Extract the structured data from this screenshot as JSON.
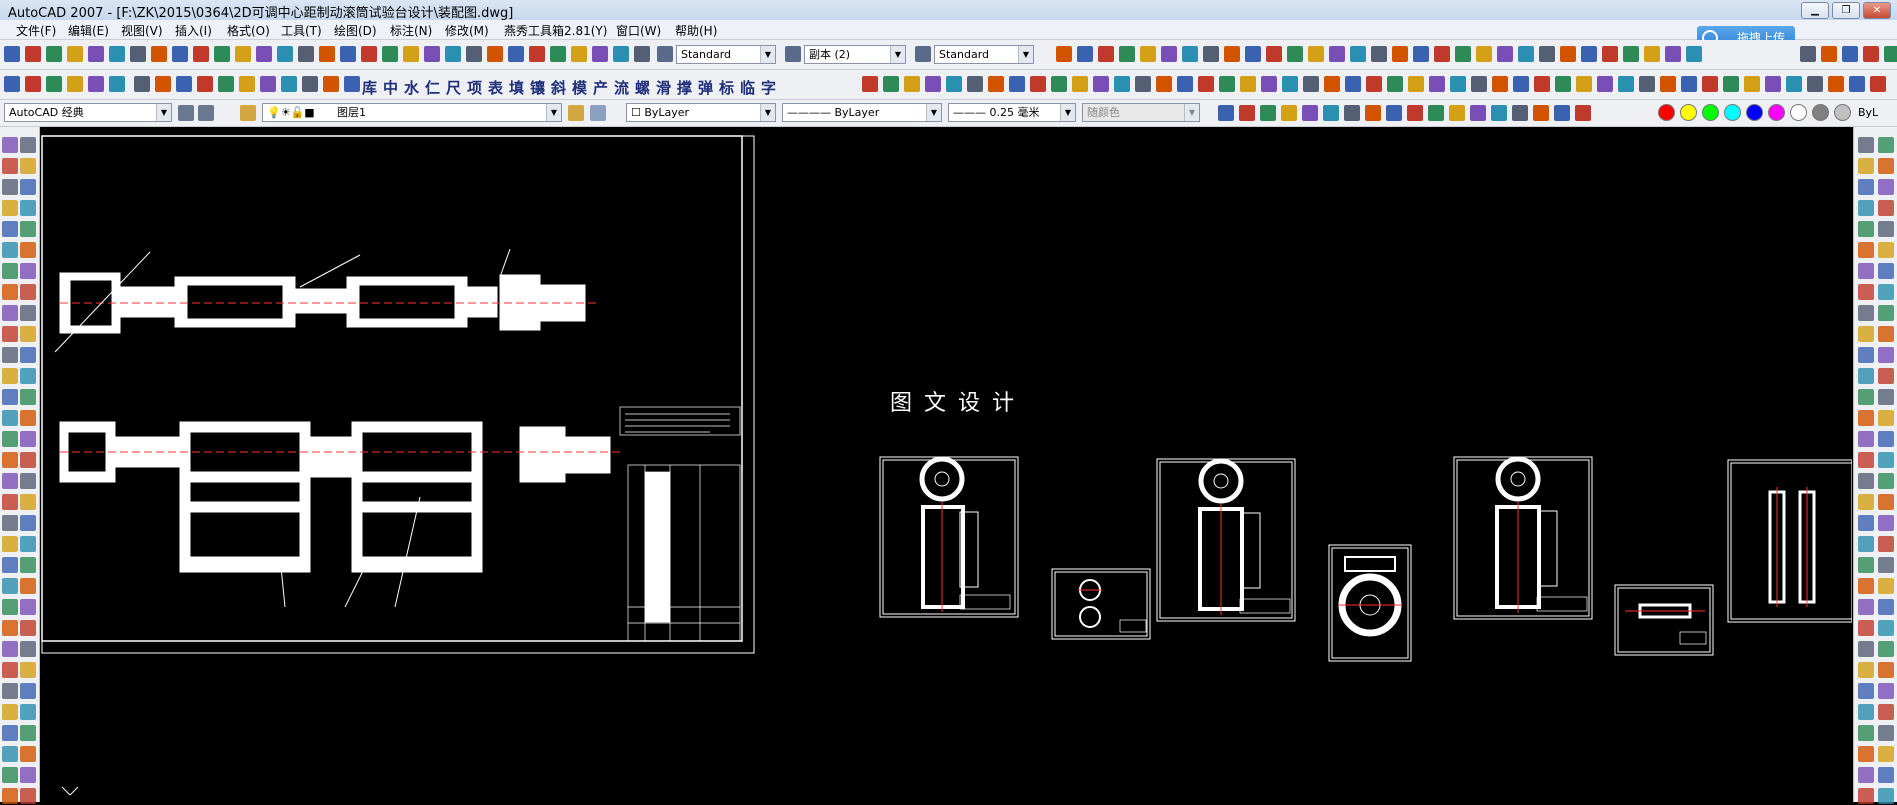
{
  "window": {
    "title": "AutoCAD 2007 - [F:\\ZK\\2015\\0364\\2D可调中心距制动滚筒试验台设计\\装配图.dwg]"
  },
  "menu": [
    "文件(F)",
    "编辑(E)",
    "视图(V)",
    "插入(I)",
    "格式(O)",
    "工具(T)",
    "绘图(D)",
    "标注(N)",
    "修改(M)",
    "燕秀工具箱2.81(Y)",
    "窗口(W)",
    "帮助(H)"
  ],
  "upload_button": {
    "label": "拖拽上传"
  },
  "toolbar1": {
    "text_style": "Standard",
    "dim_style": "副本 (2)",
    "table_style": "Standard"
  },
  "toolbar2": {
    "cjk_label": "库中水仁尺项表填镶斜模产流螺滑撑弹标临字"
  },
  "toolbar3": {
    "workspace": "AutoCAD 经典",
    "layer": "图层1",
    "color": "ByLayer",
    "linetype": "ByLayer",
    "lineweight": "0.25 毫米",
    "plot_style": "随颜色",
    "bylayer_short": "ByL"
  },
  "canvas": {
    "brand_text": "图文设计"
  },
  "colors": {
    "accent": "#2c7fd0",
    "canvas_bg": "#000000",
    "drawing": "#ffffff",
    "center_line": "#ff3030"
  },
  "swatches": [
    "#ff0000",
    "#ffff00",
    "#00ff00",
    "#00ffff",
    "#0000ff",
    "#ff00ff",
    "#ffffff",
    "#808080",
    "#c0c0c0"
  ]
}
